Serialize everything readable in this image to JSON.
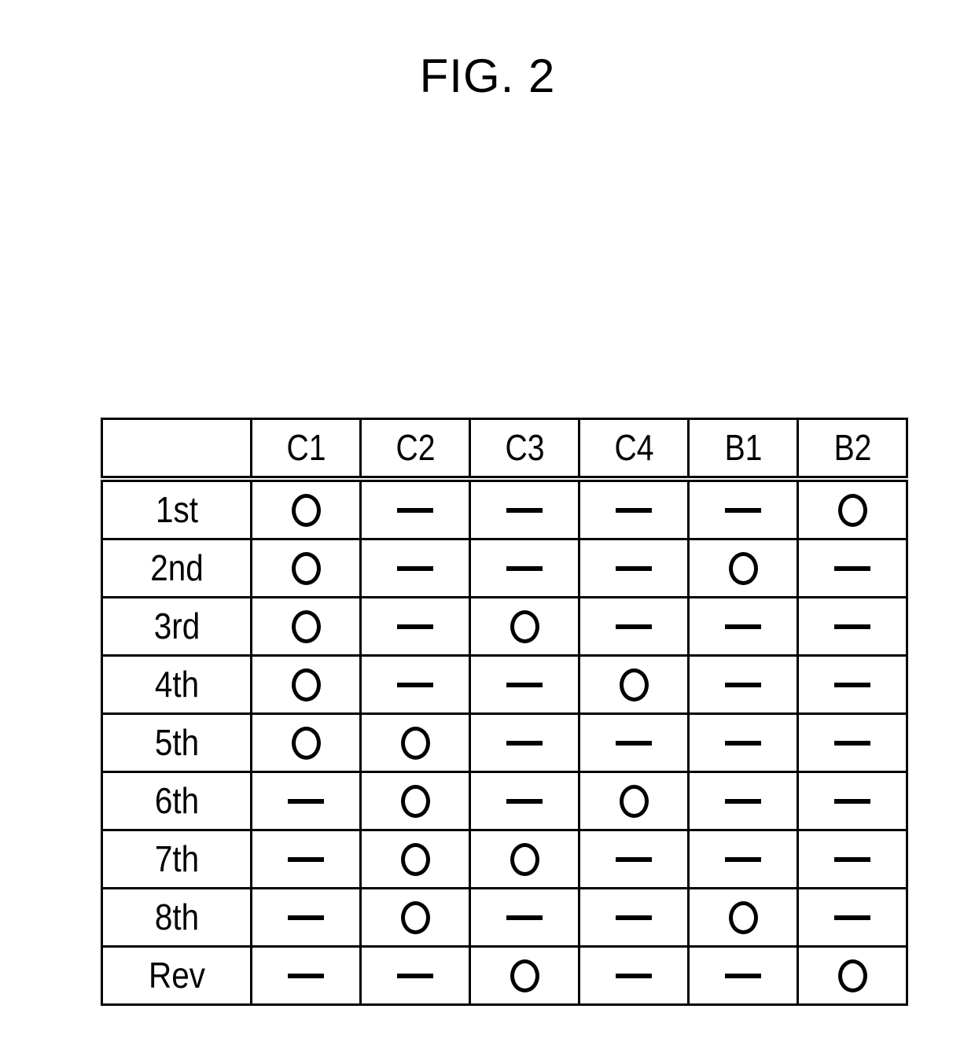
{
  "figure": {
    "title": "FIG. 2"
  },
  "table": {
    "corner_label": "",
    "column_headers": [
      "C1",
      "C2",
      "C3",
      "C4",
      "B1",
      "B2"
    ],
    "row_labels": [
      "1st",
      "2nd",
      "3rd",
      "4th",
      "5th",
      "6th",
      "7th",
      "8th",
      "Rev"
    ],
    "mark_symbols": {
      "engaged": "circle",
      "disengaged": "dash"
    },
    "rows": [
      {
        "label": "1st",
        "cells": [
          "circle",
          "dash",
          "dash",
          "dash",
          "dash",
          "circle"
        ]
      },
      {
        "label": "2nd",
        "cells": [
          "circle",
          "dash",
          "dash",
          "dash",
          "circle",
          "dash"
        ]
      },
      {
        "label": "3rd",
        "cells": [
          "circle",
          "dash",
          "circle",
          "dash",
          "dash",
          "dash"
        ]
      },
      {
        "label": "4th",
        "cells": [
          "circle",
          "dash",
          "dash",
          "circle",
          "dash",
          "dash"
        ]
      },
      {
        "label": "5th",
        "cells": [
          "circle",
          "circle",
          "dash",
          "dash",
          "dash",
          "dash"
        ]
      },
      {
        "label": "6th",
        "cells": [
          "dash",
          "circle",
          "dash",
          "circle",
          "dash",
          "dash"
        ]
      },
      {
        "label": "7th",
        "cells": [
          "dash",
          "circle",
          "circle",
          "dash",
          "dash",
          "dash"
        ]
      },
      {
        "label": "8th",
        "cells": [
          "dash",
          "circle",
          "dash",
          "dash",
          "circle",
          "dash"
        ]
      },
      {
        "label": "Rev",
        "cells": [
          "dash",
          "dash",
          "circle",
          "dash",
          "dash",
          "circle"
        ]
      }
    ]
  },
  "colors": {
    "line": "#000000",
    "background": "#ffffff",
    "text": "#000000"
  }
}
